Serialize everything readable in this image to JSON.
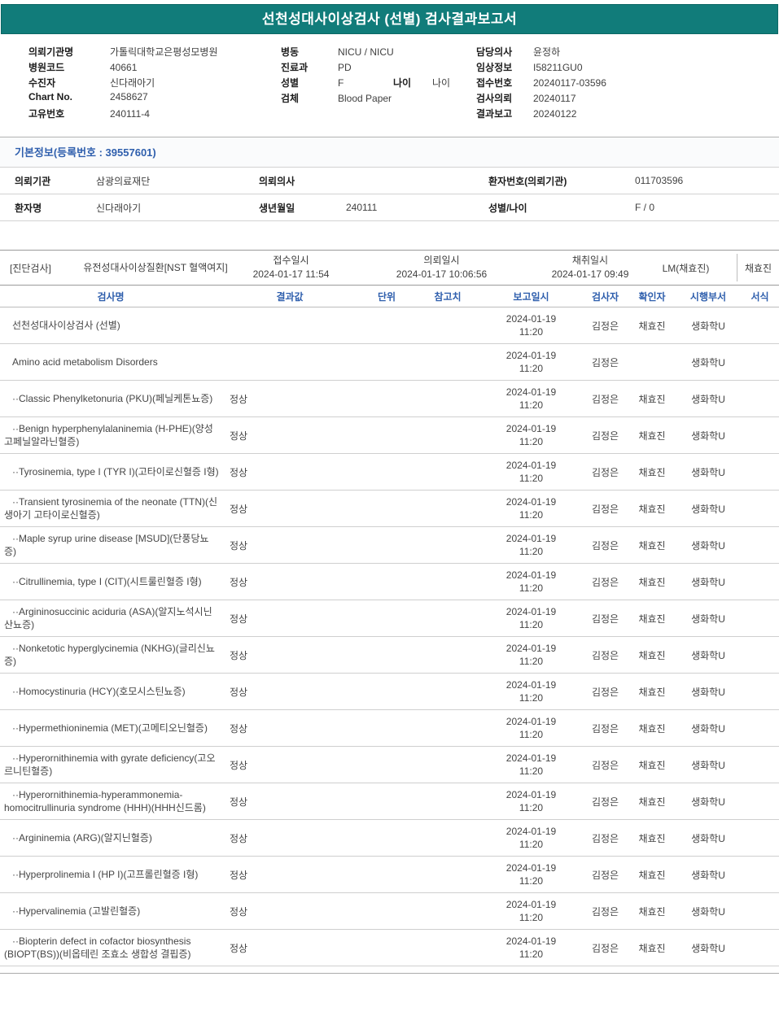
{
  "title": "선천성대사이상검사 (선별) 검사결과보고서",
  "header": {
    "left": [
      {
        "label": "의뢰기관명",
        "value": "가톨릭대학교은평성모병원"
      },
      {
        "label": "병원코드",
        "value": "40661"
      },
      {
        "label": "수진자",
        "value": "신다래아기"
      },
      {
        "label": "Chart No.",
        "value": "2458627"
      },
      {
        "label": "고유번호",
        "value": "240111-4"
      }
    ],
    "middle": [
      {
        "label": "병동",
        "value": "NICU / NICU"
      },
      {
        "label": "진료과",
        "value": "PD"
      },
      {
        "label": "성별",
        "value": "F",
        "label2": "나이",
        "value2": "나이"
      },
      {
        "label": "검체",
        "value": "Blood Paper"
      }
    ],
    "right": [
      {
        "label": "담당의사",
        "value": "윤정하"
      },
      {
        "label": "임상정보",
        "value": "I58211GU0"
      },
      {
        "label": "접수번호",
        "value": "20240117-03596"
      },
      {
        "label": "검사의뢰",
        "value": "20240117"
      },
      {
        "label": "결과보고",
        "value": "20240122"
      }
    ]
  },
  "basic_info": {
    "section_title": "기본정보(등록번호 : 39557601)",
    "row1": {
      "l1": "의뢰기관",
      "v1": "삼광의료재단",
      "l2": "의뢰의사",
      "v2": "",
      "l3": "환자번호(의뢰기관)",
      "v3": "011703596"
    },
    "row2": {
      "l1": "환자명",
      "v1": "신다래아기",
      "l2": "생년월일",
      "v2": "240111",
      "l3": "성별/나이",
      "v3": "F / 0"
    }
  },
  "diagnostic": {
    "tag": "[진단검사]",
    "test_name": "유전성대사이상질환[NST 혈액여지]",
    "received_label": "접수일시",
    "received": "2024-01-17 11:54",
    "requested_label": "의뢰일시",
    "requested": "2024-01-17 10:06:56",
    "collected_label": "채취일시",
    "collected": "2024-01-17 09:49",
    "lm": "LM(채효진)",
    "collector": "채효진"
  },
  "results": {
    "headers": {
      "name": "검사명",
      "result": "결과값",
      "unit": "단위",
      "ref": "참고치",
      "reported": "보고일시",
      "tester": "검사자",
      "confirmer": "확인자",
      "dept": "시행부서",
      "format": "서식"
    },
    "rows": [
      {
        "name": "선천성대사이상검사 (선별)",
        "result": "",
        "unit": "",
        "ref": "",
        "reported": "2024-01-19 11:20",
        "tester": "김정은",
        "confirmer": "채효진",
        "dept": "생화학U",
        "format": ""
      },
      {
        "name": "Amino acid metabolism Disorders",
        "result": "",
        "unit": "",
        "ref": "",
        "reported": "2024-01-19 11:20",
        "tester": "김정은",
        "confirmer": "",
        "dept": "생화학U",
        "format": ""
      },
      {
        "name": "··Classic Phenylketonuria (PKU)(페닐케톤뇨증)",
        "result": "정상",
        "unit": "",
        "ref": "",
        "reported": "2024-01-19 11:20",
        "tester": "김정은",
        "confirmer": "채효진",
        "dept": "생화학U",
        "format": ""
      },
      {
        "name": "··Benign hyperphenylalaninemia (H-PHE)(양성 고페닐알라닌혈증)",
        "result": "정상",
        "unit": "",
        "ref": "",
        "reported": "2024-01-19 11:20",
        "tester": "김정은",
        "confirmer": "채효진",
        "dept": "생화학U",
        "format": ""
      },
      {
        "name": "··Tyrosinemia, type I (TYR I)(고타이로신혈증 I형)",
        "result": "정상",
        "unit": "",
        "ref": "",
        "reported": "2024-01-19 11:20",
        "tester": "김정은",
        "confirmer": "채효진",
        "dept": "생화학U",
        "format": ""
      },
      {
        "name": "··Transient tyrosinemia of the neonate (TTN)(신생아기 고타이로신혈증)",
        "result": "정상",
        "unit": "",
        "ref": "",
        "reported": "2024-01-19 11:20",
        "tester": "김정은",
        "confirmer": "채효진",
        "dept": "생화학U",
        "format": ""
      },
      {
        "name": "··Maple syrup urine disease [MSUD](단풍당뇨증)",
        "result": "정상",
        "unit": "",
        "ref": "",
        "reported": "2024-01-19 11:20",
        "tester": "김정은",
        "confirmer": "채효진",
        "dept": "생화학U",
        "format": ""
      },
      {
        "name": "··Citrullinemia, type I (CIT)(시트룰린혈증 I형)",
        "result": "정상",
        "unit": "",
        "ref": "",
        "reported": "2024-01-19 11:20",
        "tester": "김정은",
        "confirmer": "채효진",
        "dept": "생화학U",
        "format": ""
      },
      {
        "name": "··Argininosuccinic aciduria (ASA)(알지노석시닌산뇨증)",
        "result": "정상",
        "unit": "",
        "ref": "",
        "reported": "2024-01-19 11:20",
        "tester": "김정은",
        "confirmer": "채효진",
        "dept": "생화학U",
        "format": ""
      },
      {
        "name": "··Nonketotic hyperglycinemia (NKHG)(글리신뇨증)",
        "result": "정상",
        "unit": "",
        "ref": "",
        "reported": "2024-01-19 11:20",
        "tester": "김정은",
        "confirmer": "채효진",
        "dept": "생화학U",
        "format": ""
      },
      {
        "name": "··Homocystinuria (HCY)(호모시스틴뇨증)",
        "result": "정상",
        "unit": "",
        "ref": "",
        "reported": "2024-01-19 11:20",
        "tester": "김정은",
        "confirmer": "채효진",
        "dept": "생화학U",
        "format": ""
      },
      {
        "name": "··Hypermethioninemia (MET)(고메티오닌혈증)",
        "result": "정상",
        "unit": "",
        "ref": "",
        "reported": "2024-01-19 11:20",
        "tester": "김정은",
        "confirmer": "채효진",
        "dept": "생화학U",
        "format": ""
      },
      {
        "name": "··Hyperornithinemia with gyrate deficiency(고오르니틴혈증)",
        "result": "정상",
        "unit": "",
        "ref": "",
        "reported": "2024-01-19 11:20",
        "tester": "김정은",
        "confirmer": "채효진",
        "dept": "생화학U",
        "format": ""
      },
      {
        "name": "··Hyperornithinemia-hyperammonemia-homocitrullinuria syndrome (HHH)(HHH신드롬)",
        "result": "정상",
        "unit": "",
        "ref": "",
        "reported": "2024-01-19 11:20",
        "tester": "김정은",
        "confirmer": "채효진",
        "dept": "생화학U",
        "format": ""
      },
      {
        "name": "··Argininemia (ARG)(알지닌혈증)",
        "result": "정상",
        "unit": "",
        "ref": "",
        "reported": "2024-01-19 11:20",
        "tester": "김정은",
        "confirmer": "채효진",
        "dept": "생화학U",
        "format": ""
      },
      {
        "name": "··Hyperprolinemia I (HP I)(고프롤린혈증 I형)",
        "result": "정상",
        "unit": "",
        "ref": "",
        "reported": "2024-01-19 11:20",
        "tester": "김정은",
        "confirmer": "채효진",
        "dept": "생화학U",
        "format": ""
      },
      {
        "name": "··Hypervalinemia (고발린혈증)",
        "result": "정상",
        "unit": "",
        "ref": "",
        "reported": "2024-01-19 11:20",
        "tester": "김정은",
        "confirmer": "채효진",
        "dept": "생화학U",
        "format": ""
      },
      {
        "name": "··Biopterin defect in cofactor biosynthesis (BIOPT(BS))(비옵테린 조효소 생합성 결핍증)",
        "result": "정상",
        "unit": "",
        "ref": "",
        "reported": "2024-01-19 11:20",
        "tester": "김정은",
        "confirmer": "채효진",
        "dept": "생화학U",
        "format": ""
      }
    ]
  }
}
